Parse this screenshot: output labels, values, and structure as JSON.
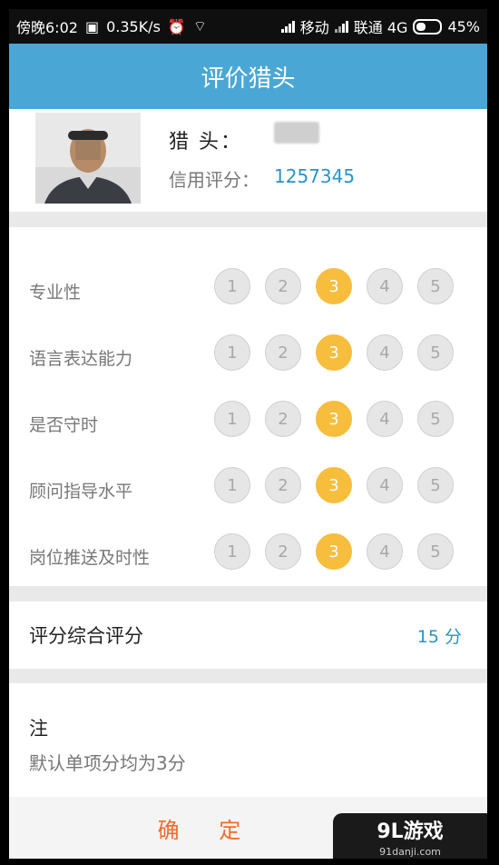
{
  "status_bar": {
    "time": "傍晚6:02",
    "speed": "0.35K/s",
    "carrier1": "移动",
    "carrier2": "联通 4G",
    "battery": "45%"
  },
  "header": {
    "title": "评价猎头"
  },
  "hunter": {
    "name_label": "猎    头：",
    "credit_label": "信用评分：",
    "credit_value": "1257345"
  },
  "ratings": {
    "options": [
      "1",
      "2",
      "3",
      "4",
      "5"
    ],
    "items": [
      {
        "label": "专业性",
        "selected": 3
      },
      {
        "label": "语言表达能力",
        "selected": 3
      },
      {
        "label": "是否守时",
        "selected": 3
      },
      {
        "label": "顾问指导水平",
        "selected": 3
      },
      {
        "label": "岗位推送及时性",
        "selected": 3
      }
    ]
  },
  "summary": {
    "label": "评分综合评分",
    "value": "15 分"
  },
  "note": {
    "title": "注",
    "text": "默认单项分均为3分"
  },
  "footer": {
    "confirm_label": "确 定"
  },
  "watermark": {
    "main": "9L游戏",
    "sub": "91danji.com"
  },
  "colors": {
    "header_bg": "#4aa7d5",
    "accent_blue": "#2a93c6",
    "selected": "#f7bd3d",
    "confirm": "#f36b2b"
  }
}
